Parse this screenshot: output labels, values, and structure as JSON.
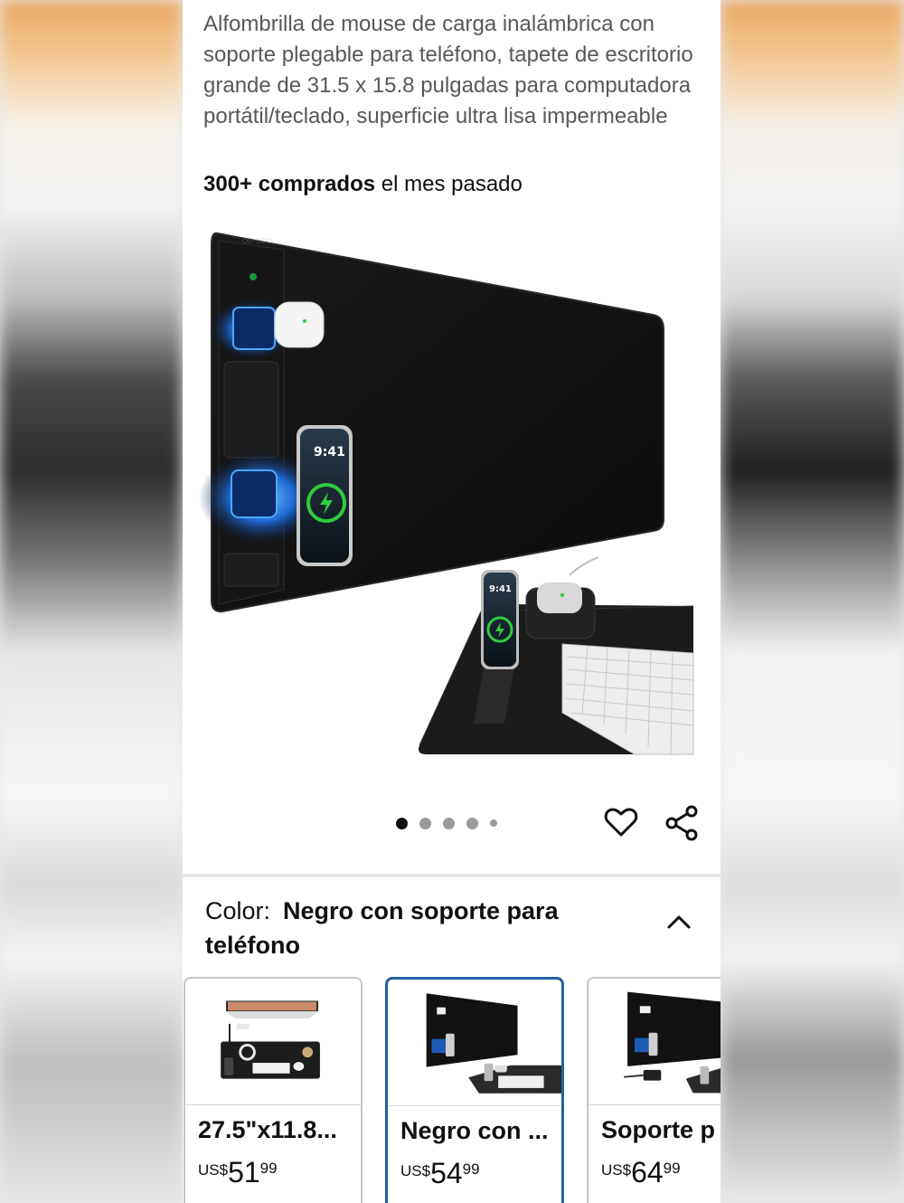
{
  "product": {
    "title": "Alfombrilla de mouse de carga inalámbrica con soporte plegable para teléfono, tapete de escritorio grande de 31.5 x 15.8 pulgadas para computadora portátil/teclado, superficie ultra lisa impermeable",
    "purchases_bold": "300+ comprados",
    "purchases_rest": " el mes pasado",
    "phone_time": "9:41"
  },
  "gallery": {
    "image_count": 5,
    "active_index": 0
  },
  "actions": {
    "favorite_icon": "heart-icon",
    "share_icon": "share-icon"
  },
  "color_selector": {
    "label": "Color:",
    "selected_value": "Negro con soporte para teléfono",
    "toggle_icon": "chevron-up-icon"
  },
  "variants": [
    {
      "name": "27.5\"x11.8...",
      "currency": "US$",
      "price_whole": "51",
      "price_fraction": "99",
      "selected": false
    },
    {
      "name": "Negro con ...",
      "currency": "US$",
      "price_whole": "54",
      "price_fraction": "99",
      "selected": true
    },
    {
      "name": "Soporte p",
      "currency": "US$",
      "price_whole": "64",
      "price_fraction": "99",
      "selected": false
    }
  ],
  "colors": {
    "selected_border": "#2162a1",
    "text": "#0f1111",
    "muted_text": "#565959"
  }
}
